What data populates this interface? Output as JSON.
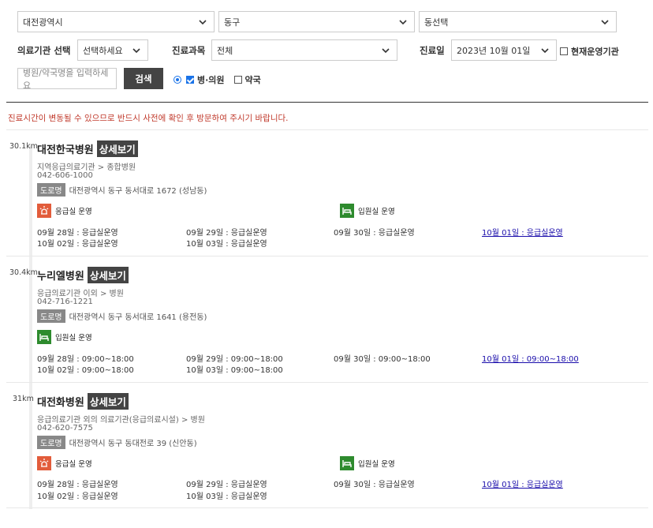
{
  "filters": {
    "region1": "대전광역시",
    "region2": "동구",
    "region3": "동선택",
    "institution_label": "의료기관 선택",
    "institution_value": "선택하세요",
    "dept_label": "진료과목",
    "dept_value": "전체",
    "date_label": "진료일",
    "date_value": "2023년 10월 01일",
    "current_open_label": "현재운영기관",
    "search_placeholder": "병원/약국명을 입력하세요",
    "search_button": "검색",
    "hospital_label": "병·의원",
    "pharmacy_label": "약국"
  },
  "notice": "진료시간이 변동될 수 있으므로 반드시 사전에 확인 후 방문하여 주시기 바랍니다.",
  "detail_label": "상세보기",
  "road_tag": "도로명",
  "badges": {
    "er": "응급실 운영",
    "ward": "입원실 운영"
  },
  "hospitals": [
    {
      "distance": "30.1km",
      "name": "대전한국병원",
      "category": "지역응급의료기관 > 종합병원",
      "phone": "042-606-1000",
      "address": "대전광역시 동구 동서대로 1672 (성남동)",
      "schedule": [
        "09월 28일 : 응급실운영",
        "09월 29일 : 응급실운영",
        "09월 30일 : 응급실운영",
        "10월 01일 : 응급실운영",
        "10월 02일 : 응급실운영",
        "10월 03일 : 응급실운영"
      ]
    },
    {
      "distance": "30.4km",
      "name": "누리엘병원",
      "category": "응급의료기관 이외 > 병원",
      "phone": "042-716-1221",
      "address": "대전광역시 동구 동서대로 1641 (용전동)",
      "schedule": [
        "09월 28일 : 09:00~18:00",
        "09월 29일 : 09:00~18:00",
        "09월 30일 : 09:00~18:00",
        "10월 01일 : 09:00~18:00",
        "10월 02일 : 09:00~18:00",
        "10월 03일 : 09:00~18:00"
      ]
    },
    {
      "distance": "31km",
      "name": "대전화병원",
      "category": "응급의료기관 외의 의료기관(응급의료시설) > 병원",
      "phone": "042-620-7575",
      "address": "대전광역시 동구 동대전로 39 (신안동)",
      "schedule": [
        "09월 28일 : 응급실운영",
        "09월 29일 : 응급실운영",
        "09월 30일 : 응급실운영",
        "10월 01일 : 응급실운영",
        "10월 02일 : 응급실운영",
        "10월 03일 : 응급실운영"
      ]
    }
  ]
}
